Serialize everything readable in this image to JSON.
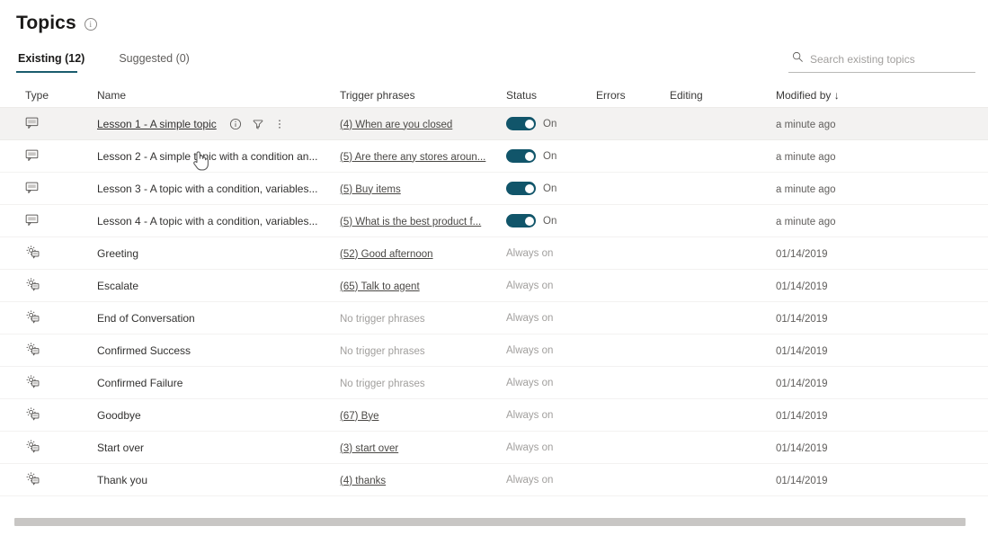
{
  "header": {
    "title": "Topics",
    "info_icon": "info-circle-icon"
  },
  "tabs": [
    {
      "label": "Existing (12)",
      "active": true
    },
    {
      "label": "Suggested (0)",
      "active": false
    }
  ],
  "search": {
    "placeholder": "Search existing topics",
    "value": "",
    "icon": "search-icon"
  },
  "table": {
    "columns": [
      {
        "key": "type",
        "label": "Type"
      },
      {
        "key": "name",
        "label": "Name"
      },
      {
        "key": "trigger",
        "label": "Trigger phrases"
      },
      {
        "key": "status",
        "label": "Status"
      },
      {
        "key": "errors",
        "label": "Errors"
      },
      {
        "key": "editing",
        "label": "Editing"
      },
      {
        "key": "modified",
        "label": "Modified by"
      }
    ],
    "sort_column": "Modified by",
    "sort_arrow": "↓",
    "rows": [
      {
        "type_icon": "chat-bubble-icon",
        "name": "Lesson 1 - A simple topic",
        "name_is_link": true,
        "hovered": true,
        "row_actions": [
          "info-circle-icon",
          "funnel-icon",
          "more-vertical-icon"
        ],
        "trigger": "(4) When are you closed",
        "trigger_is_link": true,
        "status_type": "toggle",
        "status_label": "On",
        "errors": "",
        "editing": "",
        "modified": "a minute ago"
      },
      {
        "type_icon": "chat-bubble-icon",
        "name": "Lesson 2 - A simple topic with a condition an...",
        "name_is_link": false,
        "hovered": false,
        "row_actions": [],
        "trigger": "(5) Are there any stores aroun...",
        "trigger_is_link": true,
        "status_type": "toggle",
        "status_label": "On",
        "errors": "",
        "editing": "",
        "modified": "a minute ago"
      },
      {
        "type_icon": "chat-bubble-icon",
        "name": "Lesson 3 - A topic with a condition, variables...",
        "name_is_link": false,
        "hovered": false,
        "row_actions": [],
        "trigger": "(5) Buy items",
        "trigger_is_link": true,
        "status_type": "toggle",
        "status_label": "On",
        "errors": "",
        "editing": "",
        "modified": "a minute ago"
      },
      {
        "type_icon": "chat-bubble-icon",
        "name": "Lesson 4 - A topic with a condition, variables...",
        "name_is_link": false,
        "hovered": false,
        "row_actions": [],
        "trigger": "(5) What is the best product f...",
        "trigger_is_link": true,
        "status_type": "toggle",
        "status_label": "On",
        "errors": "",
        "editing": "",
        "modified": "a minute ago"
      },
      {
        "type_icon": "system-topic-icon",
        "name": "Greeting",
        "name_is_link": false,
        "hovered": false,
        "row_actions": [],
        "trigger": "(52) Good afternoon",
        "trigger_is_link": true,
        "status_type": "text",
        "status_label": "Always on",
        "errors": "",
        "editing": "",
        "modified": "01/14/2019"
      },
      {
        "type_icon": "system-topic-icon",
        "name": "Escalate",
        "name_is_link": false,
        "hovered": false,
        "row_actions": [],
        "trigger": "(65) Talk to agent",
        "trigger_is_link": true,
        "status_type": "text",
        "status_label": "Always on",
        "errors": "",
        "editing": "",
        "modified": "01/14/2019"
      },
      {
        "type_icon": "system-topic-icon",
        "name": "End of Conversation",
        "name_is_link": false,
        "hovered": false,
        "row_actions": [],
        "trigger": "No trigger phrases",
        "trigger_is_link": false,
        "status_type": "text",
        "status_label": "Always on",
        "errors": "",
        "editing": "",
        "modified": "01/14/2019"
      },
      {
        "type_icon": "system-topic-icon",
        "name": "Confirmed Success",
        "name_is_link": false,
        "hovered": false,
        "row_actions": [],
        "trigger": "No trigger phrases",
        "trigger_is_link": false,
        "status_type": "text",
        "status_label": "Always on",
        "errors": "",
        "editing": "",
        "modified": "01/14/2019"
      },
      {
        "type_icon": "system-topic-icon",
        "name": "Confirmed Failure",
        "name_is_link": false,
        "hovered": false,
        "row_actions": [],
        "trigger": "No trigger phrases",
        "trigger_is_link": false,
        "status_type": "text",
        "status_label": "Always on",
        "errors": "",
        "editing": "",
        "modified": "01/14/2019"
      },
      {
        "type_icon": "system-topic-icon",
        "name": "Goodbye",
        "name_is_link": false,
        "hovered": false,
        "row_actions": [],
        "trigger": "(67) Bye",
        "trigger_is_link": true,
        "status_type": "text",
        "status_label": "Always on",
        "errors": "",
        "editing": "",
        "modified": "01/14/2019"
      },
      {
        "type_icon": "system-topic-icon",
        "name": "Start over",
        "name_is_link": false,
        "hovered": false,
        "row_actions": [],
        "trigger": "(3) start over",
        "trigger_is_link": true,
        "status_type": "text",
        "status_label": "Always on",
        "errors": "",
        "editing": "",
        "modified": "01/14/2019"
      },
      {
        "type_icon": "system-topic-icon",
        "name": "Thank you",
        "name_is_link": false,
        "hovered": false,
        "row_actions": [],
        "trigger": "(4) thanks",
        "trigger_is_link": true,
        "status_type": "text",
        "status_label": "Always on",
        "errors": "",
        "editing": "",
        "modified": "01/14/2019"
      }
    ]
  },
  "scrollbar": {
    "orientation": "horizontal"
  },
  "cursor": {
    "type": "pointer-hand-cursor"
  },
  "colors": {
    "accent_teal": "#11556a",
    "hover_row": "#f3f2f1",
    "text_primary": "#323130",
    "text_secondary": "#605e5c",
    "text_muted": "#a19f9d",
    "divider": "#f3f2f1"
  }
}
